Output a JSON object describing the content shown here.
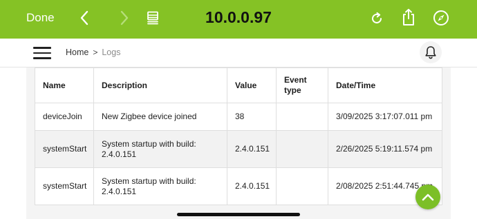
{
  "toolbar": {
    "done_label": "Done",
    "url": "10.0.0.97",
    "icons": [
      "chevron-left-icon",
      "chevron-right-icon",
      "reader-icon",
      "reload-icon",
      "share-icon",
      "compass-icon"
    ]
  },
  "header": {
    "breadcrumb": {
      "home": "Home",
      "separator": ">",
      "current": "Logs"
    }
  },
  "table": {
    "columns": [
      "Name",
      "Description",
      "Value",
      "Event type",
      "Date/Time"
    ],
    "rows": [
      {
        "name": "deviceJoin",
        "description": "New Zigbee device joined",
        "value": "38",
        "event_type": "",
        "datetime": "3/09/2025 3:17:07.011 pm"
      },
      {
        "name": "systemStart",
        "description": "System startup with build: 2.4.0.151",
        "value": "2.4.0.151",
        "event_type": "",
        "datetime": "2/26/2025 5:19:11.574 pm"
      },
      {
        "name": "systemStart",
        "description": "System startup with build: 2.4.0.151",
        "value": "2.4.0.151",
        "event_type": "",
        "datetime": "2/08/2025 2:51:44.745 pm"
      }
    ]
  },
  "colors": {
    "toolbar_green": "#85c225",
    "fab_green": "#7cbf27"
  }
}
